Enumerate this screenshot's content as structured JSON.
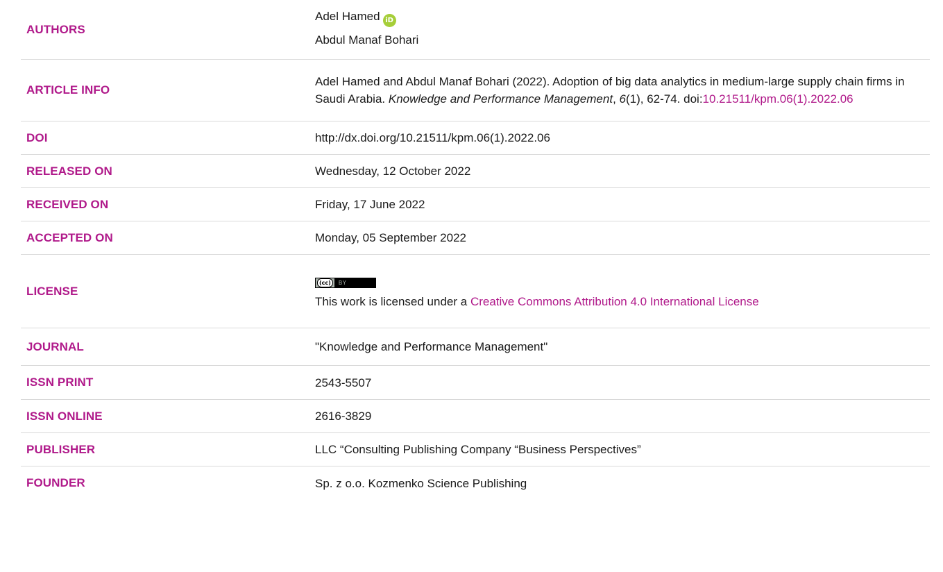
{
  "authors": {
    "label": "AUTHORS",
    "names": [
      "Adel Hamed",
      "Abdul Manaf Bohari"
    ],
    "orcid_icon_text": "iD"
  },
  "article_info": {
    "label": "ARTICLE INFO",
    "citation_pre": "Adel Hamed and Abdul Manaf Bohari (2022). Adoption of big data analytics in medium-large supply chain firms in Saudi Arabia. ",
    "journal_italic": "Knowledge and Performance Management",
    "sep1": ", ",
    "volume_italic": "6",
    "issue_pages": "(1), 62-74. doi:",
    "doi_link": "10.21511/kpm.06(1).2022.06"
  },
  "doi": {
    "label": "DOI",
    "value": "http://dx.doi.org/10.21511/kpm.06(1).2022.06"
  },
  "released_on": {
    "label": "RELEASED ON",
    "value": "Wednesday, 12 October 2022"
  },
  "received_on": {
    "label": "RECEIVED ON",
    "value": "Friday, 17 June 2022"
  },
  "accepted_on": {
    "label": "ACCEPTED ON",
    "value": "Monday, 05 September 2022"
  },
  "license": {
    "label": "LICENSE",
    "badge_cc": "(cc)",
    "badge_by": "BY",
    "text_pre": "This work is licensed under a ",
    "link": "Creative Commons Attribution 4.0 International License"
  },
  "journal": {
    "label": "JOURNAL",
    "value": "\"Knowledge and Performance Management\""
  },
  "issn_print": {
    "label": "ISSN PRINT",
    "value": "2543-5507"
  },
  "issn_online": {
    "label": "ISSN ONLINE",
    "value": "2616-3829"
  },
  "publisher": {
    "label": "PUBLISHER",
    "value": "LLC “Consulting Publishing Company “Business Perspectives”"
  },
  "founder": {
    "label": "FOUNDER",
    "value": "Sp. z o.o. Kozmenko Science Publishing"
  }
}
